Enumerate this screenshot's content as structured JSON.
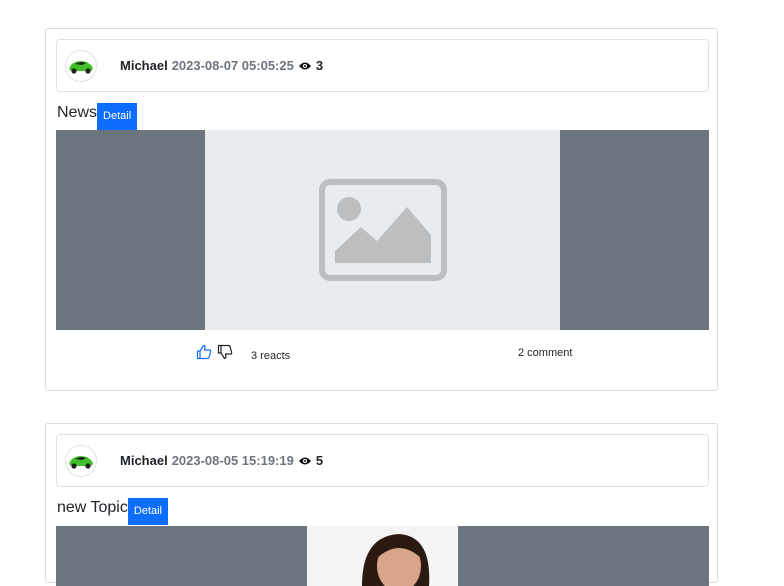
{
  "posts": [
    {
      "author": "Michael",
      "date": "2023-08-07 05:05:25",
      "views": "3",
      "title": "News",
      "detail_label": "Detail",
      "reacts_label": "3 reacts",
      "comments_label": "2 comment",
      "media": "image-placeholder-icon"
    },
    {
      "author": "Michael",
      "date": "2023-08-05 15:19:19",
      "views": "5",
      "title": "new Topic",
      "detail_label": "Detail",
      "media": "photo"
    }
  ],
  "colors": {
    "accent": "#0d6efd",
    "media_bg": "#6c757d",
    "placeholder_bg": "#e9ecef",
    "muted_text": "#6c757d"
  }
}
